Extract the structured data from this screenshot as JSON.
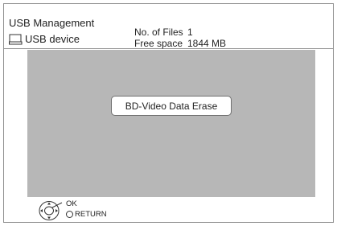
{
  "header": {
    "title": "USB Management",
    "device_label": "USB device",
    "device_icon": "usb-device-icon",
    "files_label": "No. of Files",
    "files_value": "1",
    "space_label": "Free space",
    "space_value": "1844 MB"
  },
  "menu": {
    "items": [
      {
        "label": "BD-Video Data Erase"
      }
    ]
  },
  "footer": {
    "nav_icon": "navigation-pad-icon",
    "ok_label": "OK",
    "return_label": "RETURN"
  }
}
